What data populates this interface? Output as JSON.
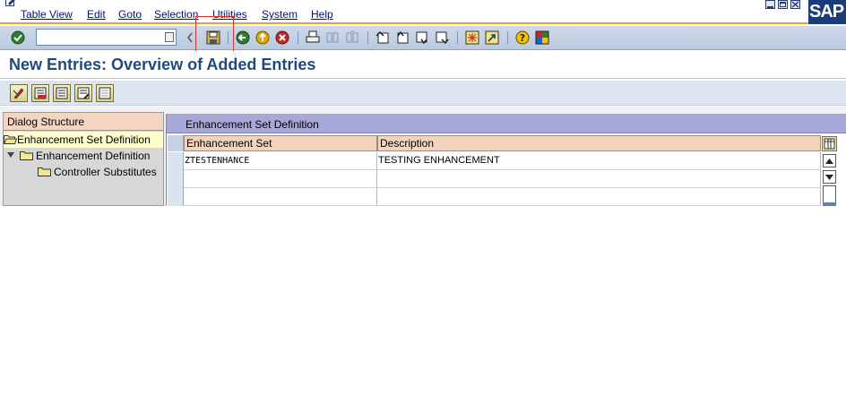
{
  "menu": {
    "items": [
      "Table View",
      "Edit",
      "Goto",
      "Selection",
      "Utilities",
      "System",
      "Help"
    ]
  },
  "logo": "SAP",
  "toolbar": {
    "command_field_value": "",
    "icons": [
      "enter-icon",
      "save-icon",
      "back-icon",
      "exit-icon",
      "cancel-icon",
      "print-icon",
      "find-icon",
      "find-next-icon",
      "first-page-icon",
      "previous-page-icon",
      "next-page-icon",
      "last-page-icon",
      "create-session-icon",
      "create-shortcut-icon",
      "help-icon",
      "customize-layout-icon"
    ]
  },
  "page": {
    "title": "New Entries: Overview of Added Entries"
  },
  "app_toolbar": {
    "icons": [
      "change-display-icon",
      "delete-icon",
      "select-all-icon",
      "select-block-icon",
      "deselect-all-icon"
    ]
  },
  "dialog_structure": {
    "header": "Dialog Structure",
    "items": [
      {
        "label": "Enhancement Set Definition",
        "level": 0,
        "selected": true
      },
      {
        "label": "Enhancement Definition",
        "level": 1,
        "selected": false
      },
      {
        "label": "Controller Substitutes",
        "level": 2,
        "selected": false
      }
    ]
  },
  "table": {
    "caption": "Enhancement Set Definition",
    "columns": [
      "Enhancement Set",
      "Description"
    ],
    "rows": [
      [
        "ZTESTENHANCE",
        "TESTING ENHANCEMENT"
      ],
      [
        "",
        ""
      ],
      [
        "",
        ""
      ]
    ]
  },
  "colors": {
    "menu_text": "#00156e",
    "title_text": "#1f4a7a",
    "header_bg": "#f2d3bd",
    "caption_bg": "#a7a7d8",
    "selected_tree_bg": "#fffcc9",
    "accent_line": "#e8a03c"
  }
}
